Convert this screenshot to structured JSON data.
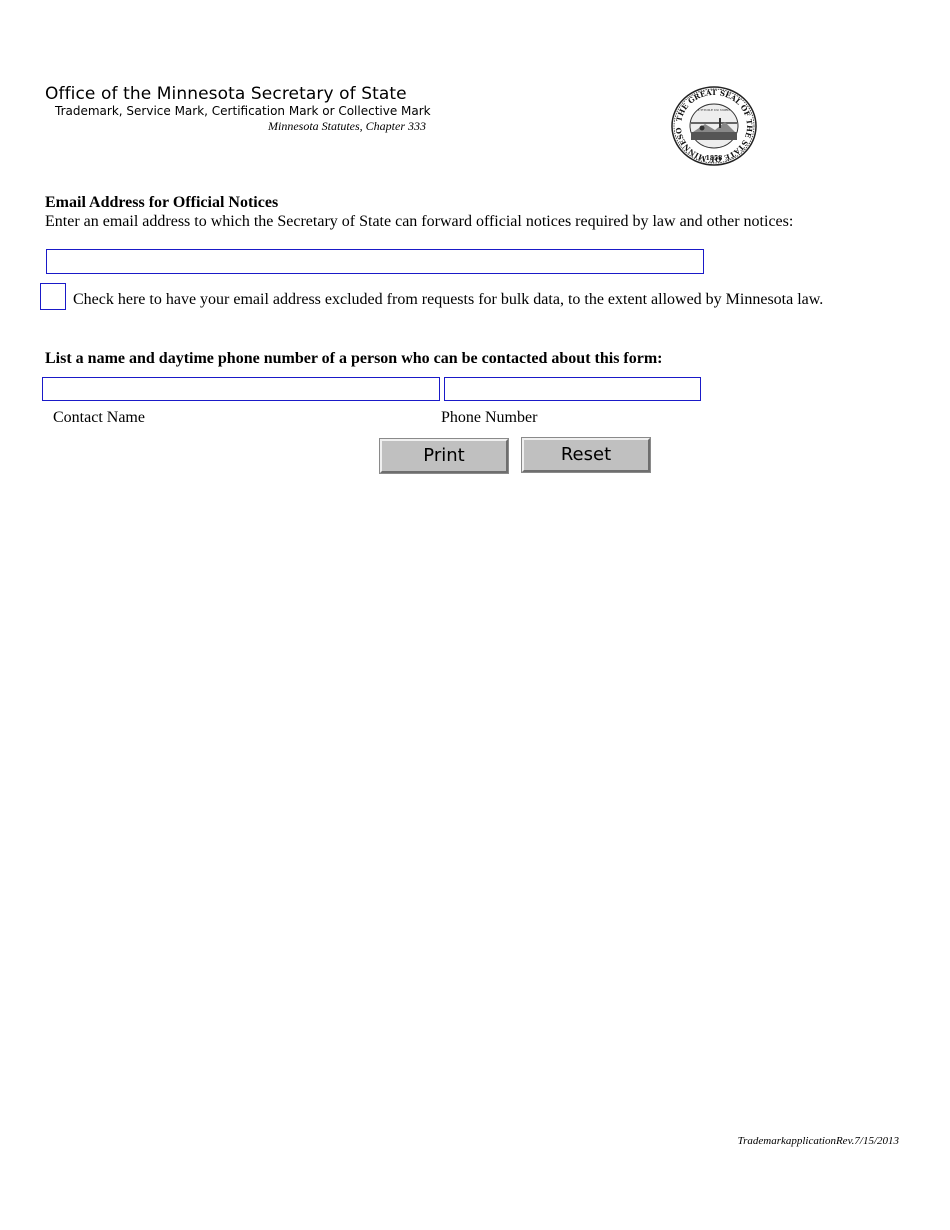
{
  "header": {
    "office_title": "Office of the Minnesota Secretary of State",
    "subtitle": "Trademark, Service Mark, Certification Mark or Collective Mark",
    "statutes": "Minnesota Statutes, Chapter 333"
  },
  "seal": {
    "icon": "state-seal-icon",
    "ring_text": "THE GREAT SEAL OF THE STATE OF MINNESOTA",
    "motto": "L'ETOILE DU NORD",
    "year": "1858"
  },
  "email_section": {
    "heading": "Email Address for Official Notices",
    "description": "Enter an email address to which the Secretary of State can forward official notices required by law and other notices:",
    "email_value": "",
    "bulk_exclusion_label": "Check here to have your email address excluded from requests for bulk data, to the extent allowed by Minnesota law."
  },
  "contact_section": {
    "heading": "List a name and daytime phone number of a person who can be contacted about this form:",
    "contact_name_value": "",
    "phone_value": "",
    "contact_name_label": "Contact Name",
    "phone_label": "Phone Number"
  },
  "buttons": {
    "print_label": "Print",
    "reset_label": "Reset"
  },
  "footer": {
    "revision": "TrademarkapplicationRev.7/15/2013"
  },
  "colors": {
    "field_border": "#1a1ac8",
    "button_face": "#c0c0c0"
  }
}
